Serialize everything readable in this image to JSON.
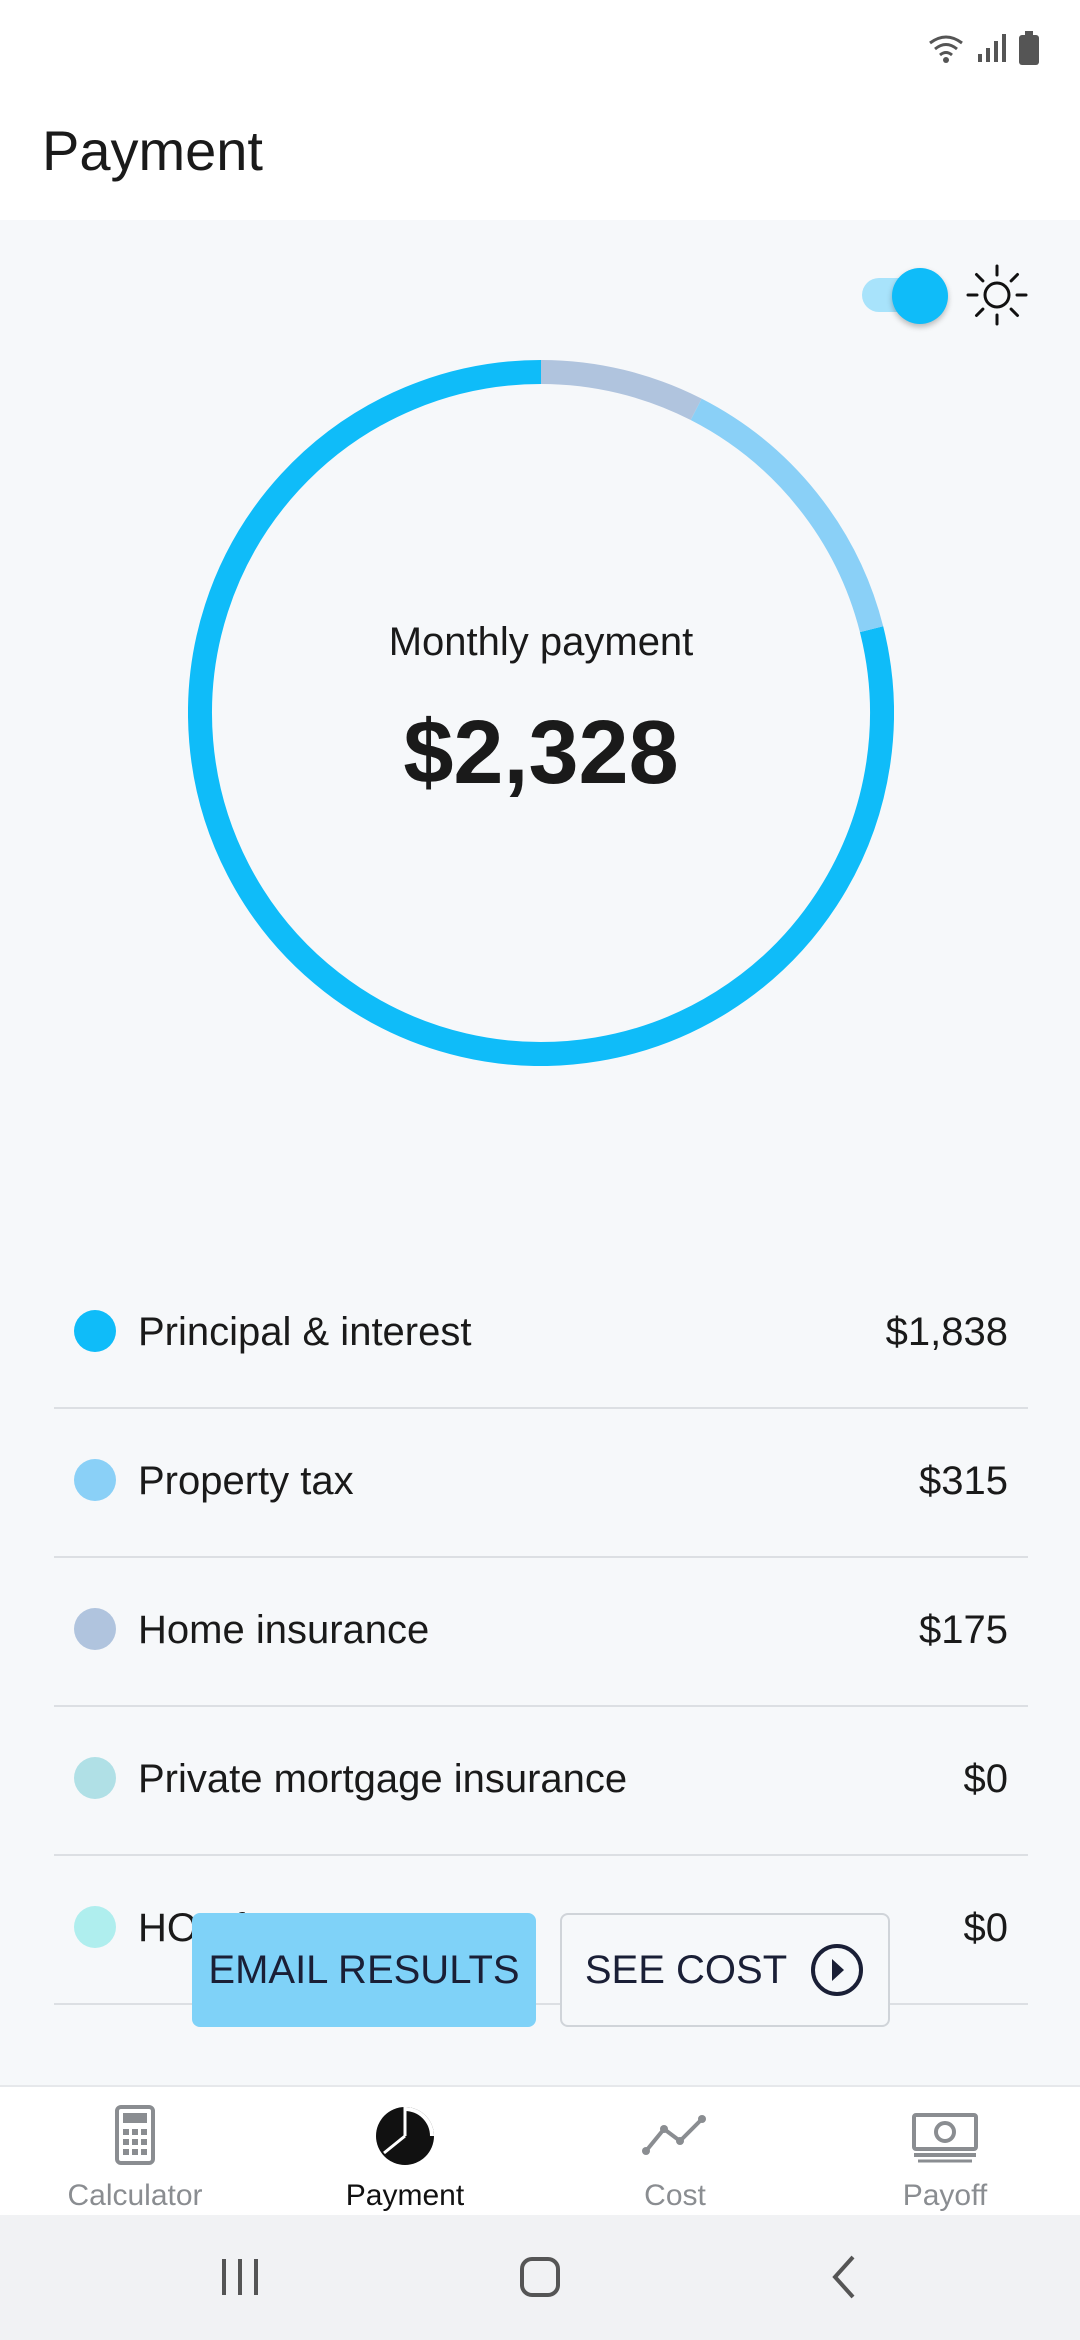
{
  "status_bar": {
    "icons": [
      "wifi-icon",
      "signal-icon",
      "battery-icon"
    ]
  },
  "header": {
    "title": "Payment"
  },
  "theme_toggle": {
    "state": "on",
    "icon": "sun-icon"
  },
  "summary": {
    "label": "Monthly payment",
    "value": "$2,328"
  },
  "breakdown": [
    {
      "label": "Principal & interest",
      "value": "$1,838",
      "amount": 1838,
      "color": "#0fbcf9"
    },
    {
      "label": "Property tax",
      "value": "$315",
      "amount": 315,
      "color": "#8ad0f7"
    },
    {
      "label": "Home insurance",
      "value": "$175",
      "amount": 175,
      "color": "#b0c4de"
    },
    {
      "label": "Private mortgage insurance",
      "value": "$0",
      "amount": 0,
      "color": "#b0e0e6"
    },
    {
      "label": "HOA fees",
      "value": "$0",
      "amount": 0,
      "color": "#afeeee"
    }
  ],
  "actions": {
    "email_label": "EMAIL RESULTS",
    "see_cost_label": "SEE COST"
  },
  "bottom_nav": [
    {
      "label": "Calculator",
      "icon": "calculator-icon",
      "active": false
    },
    {
      "label": "Payment",
      "icon": "pie-chart-icon",
      "active": true
    },
    {
      "label": "Cost",
      "icon": "line-chart-icon",
      "active": false
    },
    {
      "label": "Payoff",
      "icon": "money-icon",
      "active": false
    }
  ],
  "system_nav": [
    "recent-apps-icon",
    "home-icon",
    "back-icon"
  ],
  "colors": {
    "accent": "#0fbcf9",
    "email_button": "#7fd2f8",
    "content_background": "#f6f8fa"
  }
}
